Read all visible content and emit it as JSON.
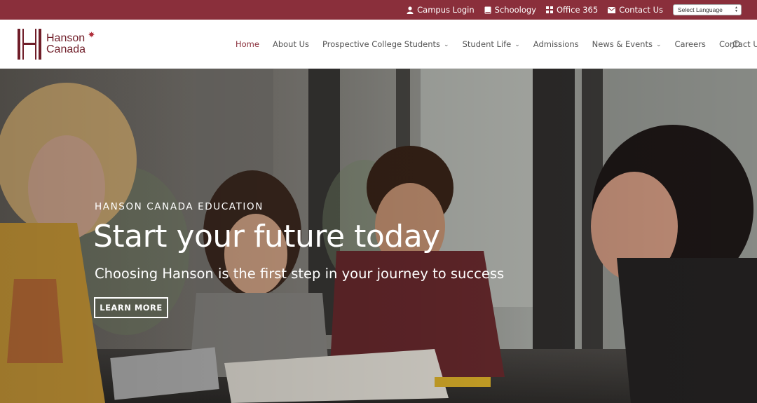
{
  "topbar": {
    "links": [
      {
        "label": "Campus Login",
        "icon": "user-icon"
      },
      {
        "label": "Schoology",
        "icon": "book-icon"
      },
      {
        "label": "Office 365",
        "icon": "grid-icon"
      },
      {
        "label": "Contact Us",
        "icon": "envelope-icon"
      }
    ],
    "language_select": "Select Language",
    "background": "#8a2f3b"
  },
  "header": {
    "logo": {
      "line1": "Hanson",
      "line2": "Canada",
      "color": "#6f1d28"
    },
    "nav": [
      {
        "label": "Home",
        "active": true,
        "dropdown": false
      },
      {
        "label": "About Us",
        "active": false,
        "dropdown": false
      },
      {
        "label": "Prospective College Students",
        "active": false,
        "dropdown": true
      },
      {
        "label": "Student Life",
        "active": false,
        "dropdown": true
      },
      {
        "label": "Admissions",
        "active": false,
        "dropdown": false
      },
      {
        "label": "News & Events",
        "active": false,
        "dropdown": true
      },
      {
        "label": "Careers",
        "active": false,
        "dropdown": false
      },
      {
        "label": "Contact Us",
        "active": false,
        "dropdown": false
      }
    ],
    "search_icon": "search-icon"
  },
  "hero": {
    "eyebrow": "HANSON CANADA EDUCATION",
    "title": "Start your future today",
    "subtitle": "Choosing Hanson is the first step in your journey to success",
    "button_label": "LEARN MORE"
  }
}
